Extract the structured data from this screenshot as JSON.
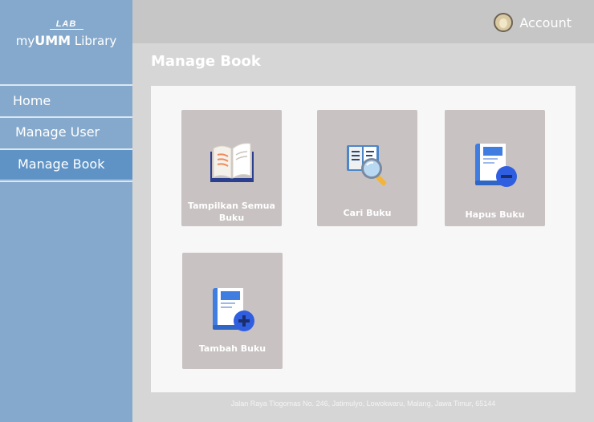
{
  "brand": {
    "top": "LAB",
    "name_prefix": "my",
    "name_bold": "UMM",
    "name_suffix": " Library"
  },
  "sidebar": {
    "items": [
      {
        "label": "Home"
      },
      {
        "label": "Manage User"
      },
      {
        "label": "Manage Book",
        "active": true
      }
    ]
  },
  "header": {
    "account_label": "Account"
  },
  "page": {
    "title": "Manage Book"
  },
  "cards": [
    {
      "label": "Tampilkan Semua Buku",
      "icon": "open-book-icon"
    },
    {
      "label": "Cari Buku",
      "icon": "search-book-icon"
    },
    {
      "label": "Hapus Buku",
      "icon": "remove-book-icon"
    },
    {
      "label": "Tambah Buku",
      "icon": "add-book-icon"
    }
  ],
  "footer": {
    "address": "Jalan Raya Tlogomas No. 246, Jatimulyo, Lowokwaru, Malang, Jawa Timur, 65144"
  },
  "colors": {
    "sidebar": "#85a9cc",
    "sidebar_active": "#5f93c6",
    "topbar": "#c6c6c6",
    "card": "#c9c2c2",
    "book_blue": "#3f7de0",
    "remove_badge": "#2f5fe0"
  }
}
